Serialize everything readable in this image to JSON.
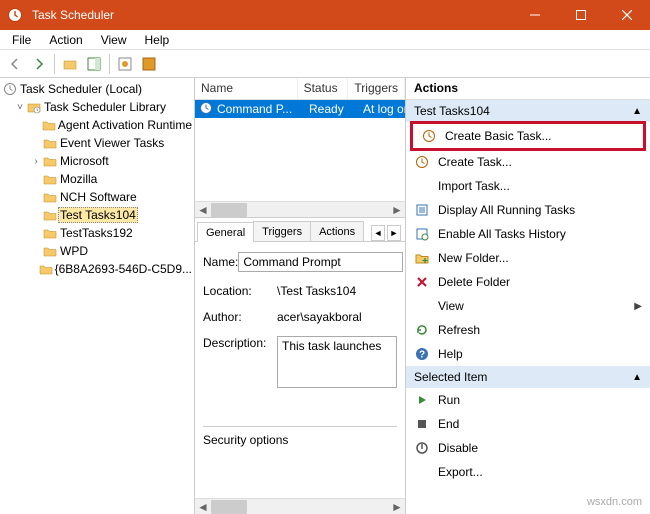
{
  "window": {
    "title": "Task Scheduler"
  },
  "menu": {
    "file": "File",
    "action": "Action",
    "view": "View",
    "help": "Help"
  },
  "tree": {
    "root": "Task Scheduler (Local)",
    "library": "Task Scheduler Library",
    "items": [
      "Agent Activation Runtime",
      "Event Viewer Tasks",
      "Microsoft",
      "Mozilla",
      "NCH Software",
      "Test Tasks104",
      "TestTasks192",
      "WPD",
      "{6B8A2693-546D-C5D9..."
    ],
    "selected": 5,
    "expandable": {
      "2": true
    }
  },
  "list": {
    "headers": {
      "name": "Name",
      "status": "Status",
      "triggers": "Triggers"
    },
    "row": {
      "name": "Command P...",
      "status": "Ready",
      "triggers": "At log on"
    }
  },
  "details": {
    "tabs": {
      "general": "General",
      "triggers": "Triggers",
      "actions": "Actions"
    },
    "name_label": "Name:",
    "name_value": "Command Prompt",
    "location_label": "Location:",
    "location_value": "\\Test Tasks104",
    "author_label": "Author:",
    "author_value": "acer\\sayakboral",
    "desc_label": "Description:",
    "desc_value": "This task launches",
    "security_label": "Security options"
  },
  "actions": {
    "header": "Actions",
    "group1": "Test Tasks104",
    "group2": "Selected Item",
    "items1": [
      {
        "label": "Create Basic Task...",
        "icon": "clock"
      },
      {
        "label": "Create Task...",
        "icon": "clock-new"
      },
      {
        "label": "Import Task...",
        "icon": "blank"
      },
      {
        "label": "Display All Running Tasks",
        "icon": "list"
      },
      {
        "label": "Enable All Tasks History",
        "icon": "history"
      },
      {
        "label": "New Folder...",
        "icon": "folder"
      },
      {
        "label": "Delete Folder",
        "icon": "delete"
      },
      {
        "label": "View",
        "icon": "blank",
        "submenu": true
      },
      {
        "label": "Refresh",
        "icon": "refresh"
      },
      {
        "label": "Help",
        "icon": "help"
      }
    ],
    "items2": [
      {
        "label": "Run",
        "icon": "run"
      },
      {
        "label": "End",
        "icon": "end"
      },
      {
        "label": "Disable",
        "icon": "disable"
      },
      {
        "label": "Export...",
        "icon": "blank"
      }
    ]
  },
  "watermark": "wsxdn.com"
}
